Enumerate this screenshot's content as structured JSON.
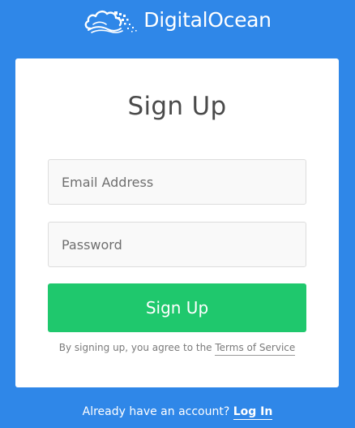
{
  "brand": {
    "name": "DigitalOcean",
    "logo_icon": "cloud-logo-icon",
    "color": "#ffffff"
  },
  "colors": {
    "background": "#2f87e8",
    "card": "#ffffff",
    "primary_button": "#1fc86d"
  },
  "signup_form": {
    "title": "Sign Up",
    "email_placeholder": "Email Address",
    "email_value": "",
    "password_placeholder": "Password",
    "password_value": "",
    "submit_label": "Sign Up",
    "terms_prefix": "By signing up, you agree to the ",
    "terms_link": "Terms of Service"
  },
  "footer": {
    "prompt": "Already have an account? ",
    "login_link": "Log In"
  }
}
